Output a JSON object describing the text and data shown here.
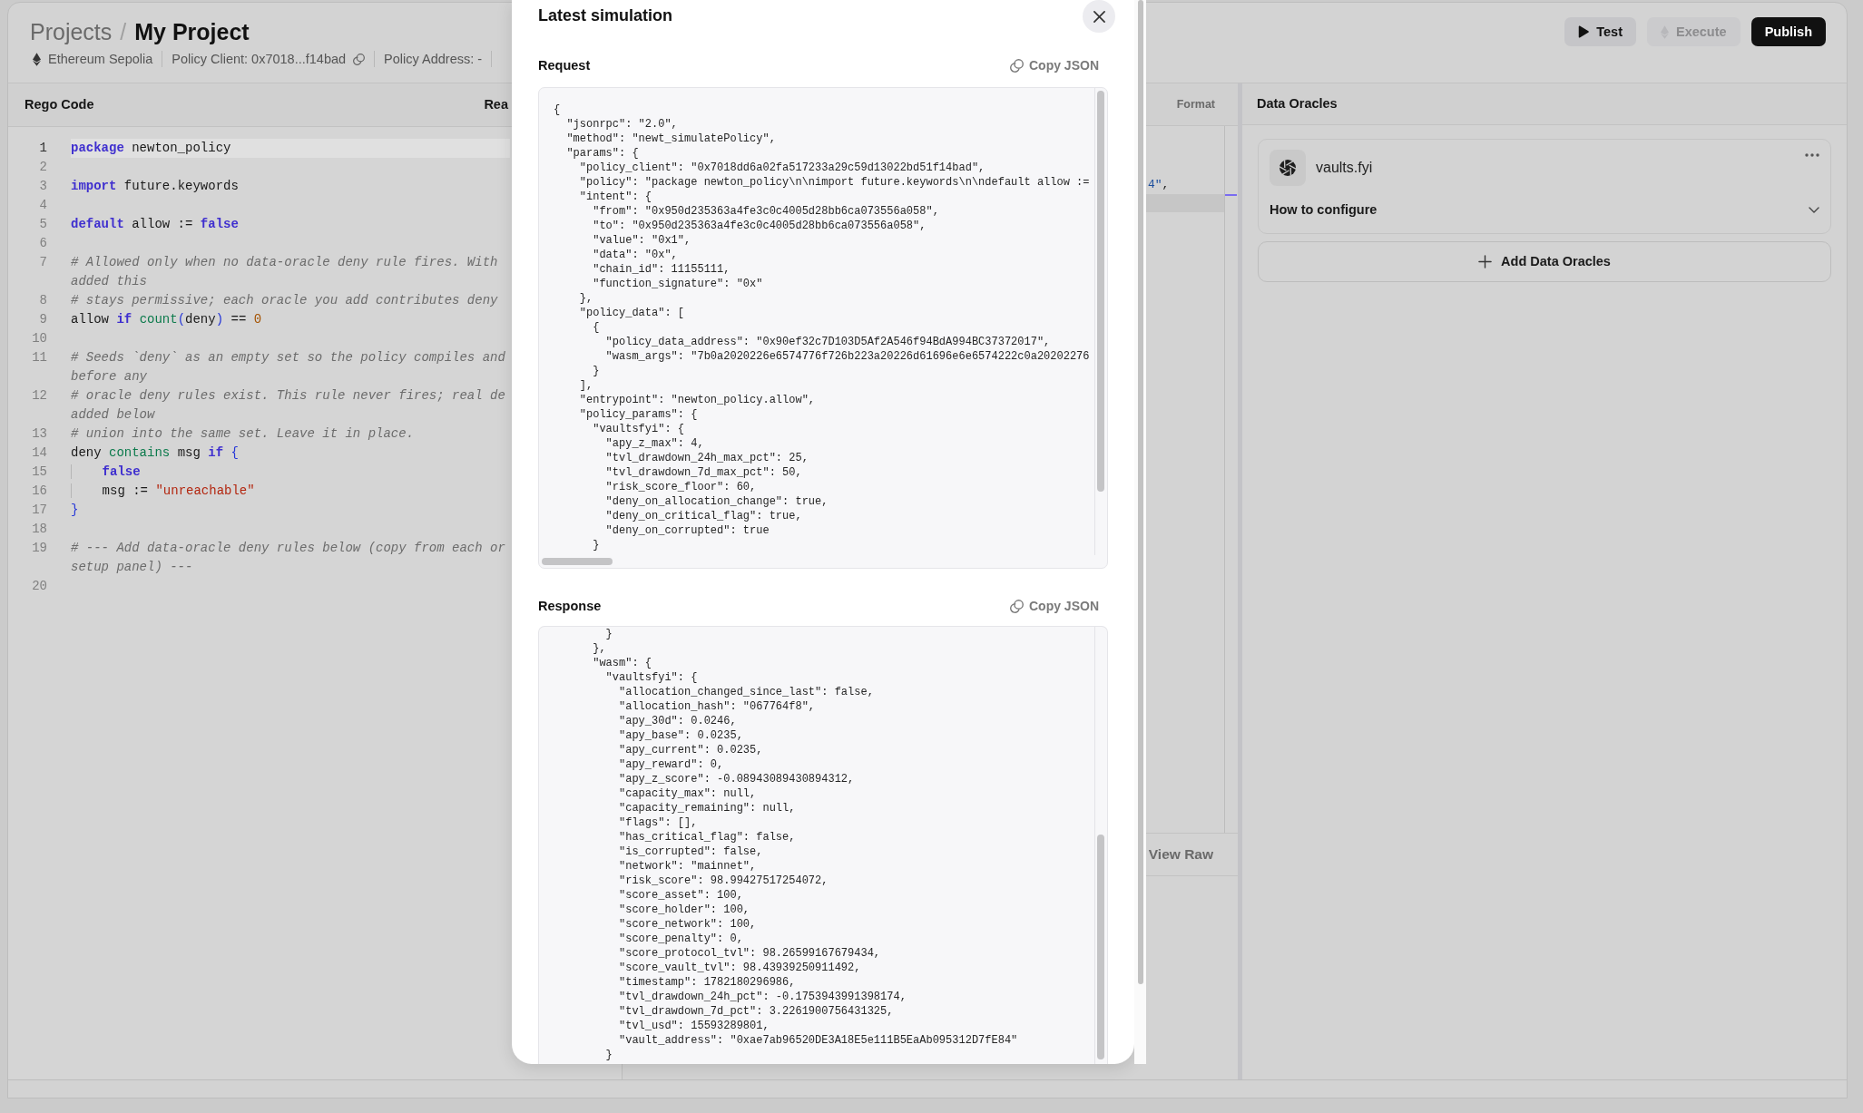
{
  "header": {
    "breadcrumb": [
      {
        "label": "Projects",
        "current": false
      },
      {
        "label": "My Project",
        "current": true
      }
    ],
    "breadcrumb_separator": "/",
    "meta": [
      {
        "kind": "network",
        "text": "Ethereum Sepolia"
      },
      {
        "kind": "copyable",
        "text": "Policy Client: 0x7018...f14bad"
      },
      {
        "kind": "plain",
        "text": "Policy Address: -"
      }
    ],
    "actions": [
      {
        "kind": "test",
        "label": "Test",
        "disabled": false
      },
      {
        "kind": "execute",
        "label": "Execute",
        "disabled": true
      },
      {
        "kind": "publish",
        "label": "Publish",
        "disabled": false
      }
    ]
  },
  "editor": {
    "title": "Rego Code",
    "toolbar_label": "Rea",
    "lines": [
      {
        "number": "1",
        "active": true,
        "rows": [
          [
            {
              "kind": "keyword",
              "text": "package"
            },
            {
              "kind": "plain",
              "text": " newton_policy"
            }
          ]
        ]
      },
      {
        "number": "2",
        "active": false
      },
      {
        "number": "3",
        "active": false,
        "rows": [
          [
            {
              "kind": "keyword",
              "text": "import"
            },
            {
              "kind": "plain",
              "text": " future.keywords"
            }
          ]
        ]
      },
      {
        "number": "4",
        "active": false
      },
      {
        "number": "5",
        "active": false,
        "rows": [
          [
            {
              "kind": "keyword",
              "text": "default"
            },
            {
              "kind": "plain",
              "text": " allow := "
            },
            {
              "kind": "keyword",
              "text": "false"
            }
          ]
        ]
      },
      {
        "number": "6",
        "active": false
      },
      {
        "number": "7",
        "active": false,
        "rows": [
          [
            {
              "kind": "comment",
              "text": "# Allowed only when no data-oracle deny rule fires. With"
            }
          ],
          [
            {
              "kind": "comment",
              "text": "added this"
            }
          ]
        ]
      },
      {
        "number": "8",
        "active": false,
        "rows": [
          [
            {
              "kind": "comment",
              "text": "# stays permissive; each oracle you add contributes deny"
            }
          ]
        ]
      },
      {
        "number": "9",
        "active": false,
        "rows": [
          [
            {
              "kind": "plain",
              "text": "allow "
            },
            {
              "kind": "keyword",
              "text": "if"
            },
            {
              "kind": "plain",
              "text": " "
            },
            {
              "kind": "builtin",
              "text": "count"
            },
            {
              "kind": "punct",
              "text": "("
            },
            {
              "kind": "plain",
              "text": "deny"
            },
            {
              "kind": "punct",
              "text": ")"
            },
            {
              "kind": "plain",
              "text": " == "
            },
            {
              "kind": "number",
              "text": "0"
            }
          ]
        ]
      },
      {
        "number": "10",
        "active": false
      },
      {
        "number": "11",
        "active": false,
        "rows": [
          [
            {
              "kind": "comment",
              "text": "# Seeds `deny` as an empty set so the policy compiles and"
            }
          ],
          [
            {
              "kind": "comment",
              "text": "before any"
            }
          ]
        ]
      },
      {
        "number": "12",
        "active": false,
        "rows": [
          [
            {
              "kind": "comment",
              "text": "# oracle deny rules exist. This rule never fires; real de"
            }
          ],
          [
            {
              "kind": "comment",
              "text": "added below"
            }
          ]
        ]
      },
      {
        "number": "13",
        "active": false,
        "rows": [
          [
            {
              "kind": "comment",
              "text": "# union into the same set. Leave it in place."
            }
          ]
        ]
      },
      {
        "number": "14",
        "active": false,
        "rows": [
          [
            {
              "kind": "plain",
              "text": "deny "
            },
            {
              "kind": "builtin",
              "text": "contains"
            },
            {
              "kind": "plain",
              "text": " msg "
            },
            {
              "kind": "keyword",
              "text": "if"
            },
            {
              "kind": "plain",
              "text": " "
            },
            {
              "kind": "punct",
              "text": "{"
            }
          ]
        ]
      },
      {
        "number": "15",
        "active": false,
        "rows": [
          [
            {
              "kind": "indent",
              "text": "    "
            },
            {
              "kind": "keyword",
              "text": "false"
            }
          ]
        ]
      },
      {
        "number": "16",
        "active": false,
        "rows": [
          [
            {
              "kind": "indent",
              "text": "    "
            },
            {
              "kind": "plain",
              "text": "msg := "
            },
            {
              "kind": "string",
              "text": "\"unreachable\""
            }
          ]
        ]
      },
      {
        "number": "17",
        "active": false,
        "rows": [
          [
            {
              "kind": "punct",
              "text": "}"
            }
          ]
        ]
      },
      {
        "number": "18",
        "active": false
      },
      {
        "number": "19",
        "active": false,
        "rows": [
          [
            {
              "kind": "comment",
              "text": "# --- Add data-oracle deny rules below (copy from each or"
            }
          ],
          [
            {
              "kind": "comment",
              "text": "setup panel) ---"
            }
          ]
        ]
      },
      {
        "number": "20",
        "active": false
      }
    ]
  },
  "output_panel": {
    "action": "Format",
    "lines": [
      {
        "active": false,
        "tokens": [
          {
            "kind": "string",
            "text": "4\""
          },
          {
            "kind": "plain",
            "text": ","
          }
        ]
      },
      {
        "active": true
      }
    ],
    "footer_button": "View Raw"
  },
  "data_oracles": {
    "title": "Data Oracles",
    "items": [
      {
        "name": "vaults.fyi",
        "toggle_label": "How to configure",
        "expanded": false
      }
    ],
    "add_button": "Add Data Oracles"
  },
  "modal": {
    "title": "Latest simulation",
    "sections": [
      {
        "label": "Request",
        "copy_label": "Copy JSON",
        "lines": [
          "{",
          "  \"jsonrpc\": \"2.0\",",
          "  \"method\": \"newt_simulatePolicy\",",
          "  \"params\": {",
          "    \"policy_client\": \"0x7018dd6a02fa517233a29c59d13022bd51f14bad\",",
          "    \"policy\": \"package newton_policy\\n\\nimport future.keywords\\n\\ndefault allow :=",
          "    \"intent\": {",
          "      \"from\": \"0x950d235363a4fe3c0c4005d28bb6ca073556a058\",",
          "      \"to\": \"0x950d235363a4fe3c0c4005d28bb6ca073556a058\",",
          "      \"value\": \"0x1\",",
          "      \"data\": \"0x\",",
          "      \"chain_id\": 11155111,",
          "      \"function_signature\": \"0x\"",
          "    },",
          "    \"policy_data\": [",
          "      {",
          "        \"policy_data_address\": \"0x90ef32c7D103D5Af2A546f94BdA994BC37372017\",",
          "        \"wasm_args\": \"7b0a2020226e6574776f726b223a20226d61696e6e6574222c0a20202276",
          "      }",
          "    ],",
          "    \"entrypoint\": \"newton_policy.allow\",",
          "    \"policy_params\": {",
          "      \"vaultsfyi\": {",
          "        \"apy_z_max\": 4,",
          "        \"tvl_drawdown_24h_max_pct\": 25,",
          "        \"tvl_drawdown_7d_max_pct\": 50,",
          "        \"risk_score_floor\": 60,",
          "        \"deny_on_allocation_change\": true,",
          "        \"deny_on_critical_flag\": true,",
          "        \"deny_on_corrupted\": true",
          "      }"
        ]
      },
      {
        "label": "Response",
        "copy_label": "Copy JSON",
        "lines": [
          "        }",
          "      },",
          "      \"wasm\": {",
          "        \"vaultsfyi\": {",
          "          \"allocation_changed_since_last\": false,",
          "          \"allocation_hash\": \"067764f8\",",
          "          \"apy_30d\": 0.0246,",
          "          \"apy_base\": 0.0235,",
          "          \"apy_current\": 0.0235,",
          "          \"apy_reward\": 0,",
          "          \"apy_z_score\": -0.08943089430894312,",
          "          \"capacity_max\": null,",
          "          \"capacity_remaining\": null,",
          "          \"flags\": [],",
          "          \"has_critical_flag\": false,",
          "          \"is_corrupted\": false,",
          "          \"network\": \"mainnet\",",
          "          \"risk_score\": 98.99427517254072,",
          "          \"score_asset\": 100,",
          "          \"score_holder\": 100,",
          "          \"score_network\": 100,",
          "          \"score_penalty\": 0,",
          "          \"score_protocol_tvl\": 98.26599167679434,",
          "          \"score_vault_tvl\": 98.43939250911492,",
          "          \"timestamp\": 1782180296986,",
          "          \"tvl_drawdown_24h_pct\": -0.1753943991398174,",
          "          \"tvl_drawdown_7d_pct\": 3.2261900756431325,",
          "          \"tvl_usd\": 15593289801,",
          "          \"vault_address\": \"0xae7ab96520DE3A18E5e111B5EaAb095312D7fE84\"",
          "        }"
        ]
      }
    ]
  }
}
